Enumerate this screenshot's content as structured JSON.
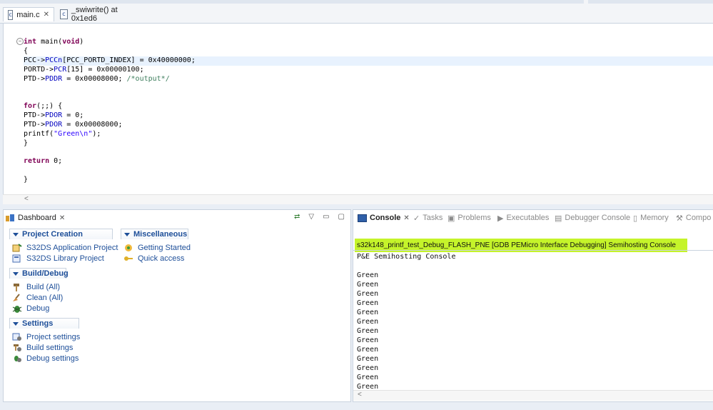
{
  "editor": {
    "tabs": [
      {
        "label": "main.c",
        "icon": "c-file-icon",
        "active": true
      },
      {
        "label": "_swiwrite() at 0x1ed6",
        "icon": "c-file-icon",
        "active": false
      }
    ],
    "code": {
      "l1a": "int",
      "l1b": " main(",
      "l1c": "void",
      "l1d": ")",
      "l2": "{",
      "l3a": "PCC->",
      "l3b": "PCCn",
      "l3c": "[PCC_PORTD_INDEX] = 0x40000000;",
      "l4a": "PORTD->",
      "l4b": "PCR",
      "l4c": "[15] = 0x00000100;",
      "l5a": "PTD->",
      "l5b": "PDDR",
      "l5c": " = 0x00008000; ",
      "l5d": "/*output*/",
      "l6a": "for",
      "l6b": "(;;) {",
      "l7a": "PTD->",
      "l7b": "PDOR",
      "l7c": " = 0;",
      "l8a": "PTD->",
      "l8b": "PDOR",
      "l8c": " = 0x00008000;",
      "l9a": "printf(",
      "l9b": "\"Green\\n\"",
      "l9c": ");",
      "l10": "}",
      "l11a": "return",
      "l11b": " 0;",
      "l12": "}"
    }
  },
  "dashboard": {
    "tab_label": "Dashboard",
    "project_creation": {
      "title": "Project Creation",
      "items": [
        "S32DS Application Project",
        "S32DS Library Project"
      ]
    },
    "miscellaneous": {
      "title": "Miscellaneous",
      "items": [
        "Getting Started",
        "Quick access"
      ]
    },
    "build_debug": {
      "title": "Build/Debug",
      "items": [
        "Build   (All)",
        "Clean   (All)",
        "Debug"
      ]
    },
    "settings": {
      "title": "Settings",
      "items": [
        "Project settings",
        "Build settings",
        "Debug settings"
      ]
    }
  },
  "console": {
    "tabs": [
      "Console",
      "Tasks",
      "Problems",
      "Executables",
      "Debugger Console",
      "Memory",
      "Compo"
    ],
    "label": "s32k148_printf_test_Debug_FLASH_PNE [GDB PEMicro Interface Debugging] Semihosting Console",
    "lines": [
      "P&E Semihosting Console",
      "",
      "Green",
      "Green",
      "Green",
      "Green",
      "Green",
      "Green",
      "Green",
      "Green",
      "Green",
      "Green",
      "Green",
      "Green",
      "Green"
    ]
  },
  "colors": {
    "highlight": "#c5f42a",
    "link": "#1e4f99"
  }
}
